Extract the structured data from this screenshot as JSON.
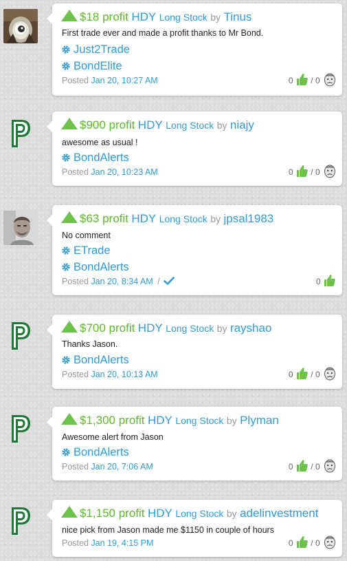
{
  "colors": {
    "profit": "#5cb82c",
    "link": "#2f9bd6",
    "muted": "#999999",
    "thumb": "#6cc24a"
  },
  "feed": [
    {
      "avatar": "owl-photo",
      "profit": "$18 profit",
      "ticker": "HDY",
      "stock_type": "Long Stock",
      "by": "by",
      "user": "Tinus",
      "comment": "First trade ever and made a profit thanks to Mr Bond.",
      "brokers": [
        "Just2Trade",
        "BondElite"
      ],
      "posted": "Posted",
      "time": "Jan 20, 10:27 AM",
      "verified": false,
      "likes": "0",
      "separator": "/",
      "dislikes": "0"
    },
    {
      "avatar": "p-logo",
      "profit": "$900 profit",
      "ticker": "HDY",
      "stock_type": "Long Stock",
      "by": "by",
      "user": "niajy",
      "comment": "awesome as usual !",
      "brokers": [
        "BondAlerts"
      ],
      "posted": "Posted",
      "time": "Jan 20, 10:23 AM",
      "verified": false,
      "likes": "0",
      "separator": "/",
      "dislikes": "0"
    },
    {
      "avatar": "man-photo",
      "profit": "$63 profit",
      "ticker": "HDY",
      "stock_type": "Long Stock",
      "by": "by",
      "user": "jpsal1983",
      "comment": "No comment",
      "brokers": [
        "ETrade",
        "BondAlerts"
      ],
      "posted": "Posted",
      "time": "Jan 20, 8:34 AM",
      "verified": true,
      "verified_separator": "/",
      "likes": "0"
    },
    {
      "avatar": "p-logo",
      "profit": "$700 profit",
      "ticker": "HDY",
      "stock_type": "Long Stock",
      "by": "by",
      "user": "rayshao",
      "comment": "Thanks Jason.",
      "brokers": [
        "BondAlerts"
      ],
      "posted": "Posted",
      "time": "Jan 20, 10:13 AM",
      "verified": false,
      "likes": "0",
      "separator": "/",
      "dislikes": "0"
    },
    {
      "avatar": "p-logo",
      "profit": "$1,300 profit",
      "ticker": "HDY",
      "stock_type": "Long Stock",
      "by": "by",
      "user": "Plyman",
      "comment": "Awesome alert from Jason",
      "brokers": [
        "BondAlerts"
      ],
      "posted": "Posted",
      "time": "Jan 20, 7:06 AM",
      "verified": false,
      "likes": "0",
      "separator": "/",
      "dislikes": "0"
    },
    {
      "avatar": "p-logo",
      "profit": "$1,150 profit",
      "ticker": "HDY",
      "stock_type": "Long Stock",
      "by": "by",
      "user": "adelinvestment",
      "comment": "nice pick from Jason made me $1150 in couple of hours",
      "brokers": [],
      "posted": "Posted",
      "time": "Jan 19, 4:15 PM",
      "verified": false,
      "likes": "0",
      "separator": "/",
      "dislikes": "0"
    }
  ]
}
